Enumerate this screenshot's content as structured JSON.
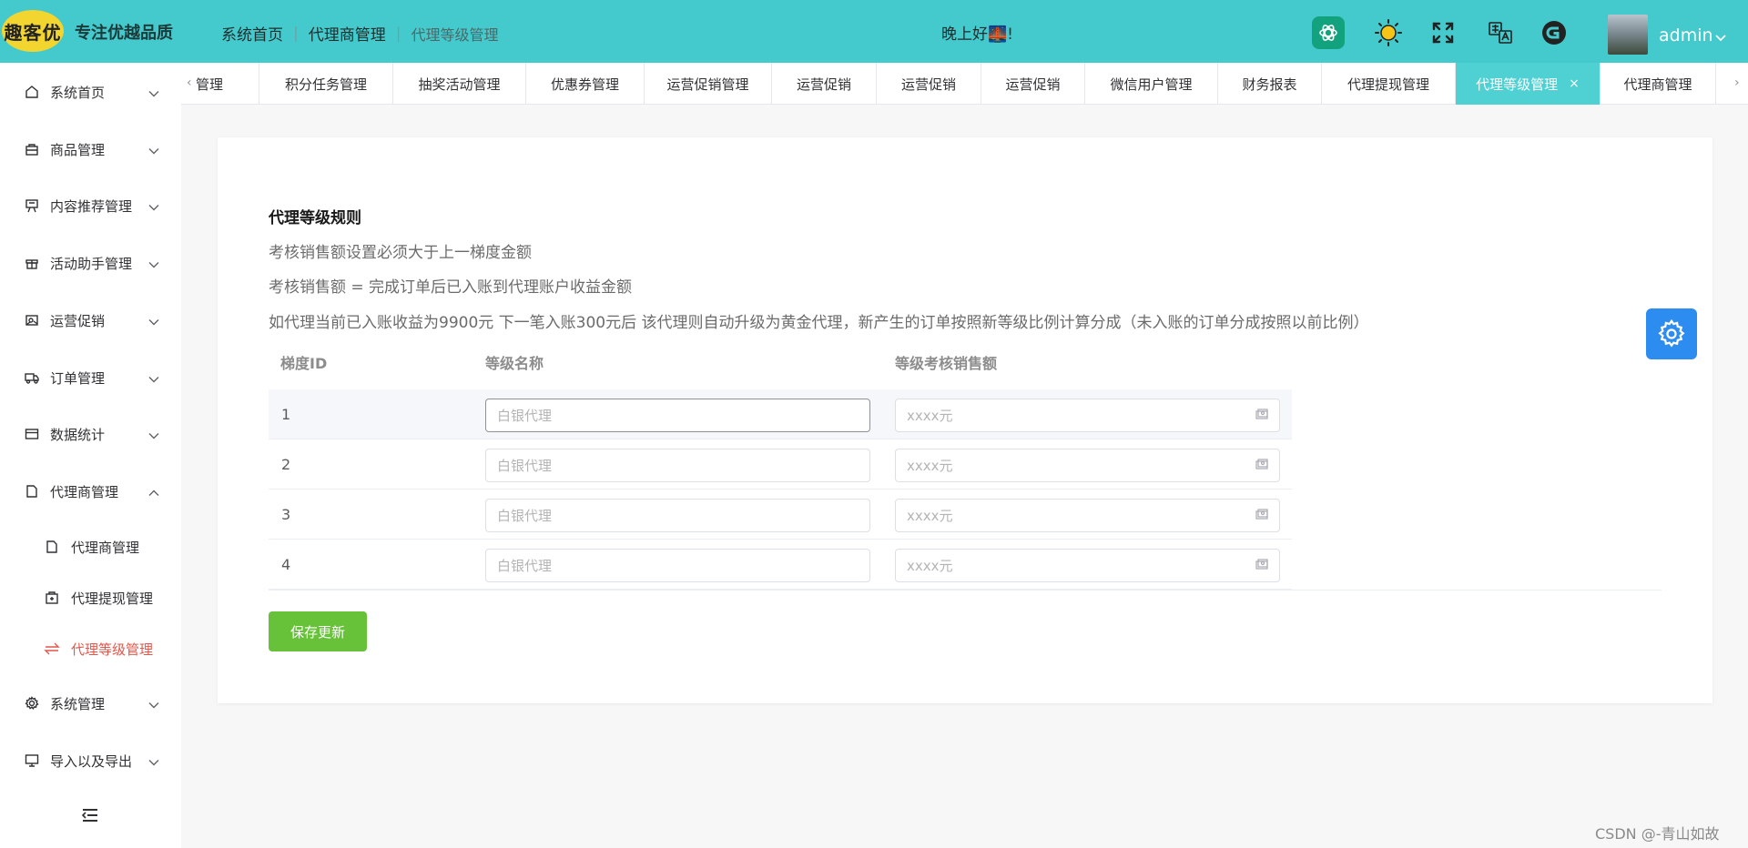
{
  "header": {
    "logo_text": "趣客优",
    "slogan": "专注优越品质",
    "breadcrumb": [
      "系统首页",
      "代理商管理",
      "代理等级管理"
    ],
    "greeting": "晚上好🌉!",
    "icons": [
      "chatgpt-icon",
      "sun-icon",
      "fullscreen-icon",
      "translate-icon",
      "gitee-icon"
    ],
    "username": "admin"
  },
  "sidebar": {
    "items": [
      {
        "label": "系统首页",
        "icon": "home-icon"
      },
      {
        "label": "商品管理",
        "icon": "bag-icon"
      },
      {
        "label": "内容推荐管理",
        "icon": "presentation-icon"
      },
      {
        "label": "活动助手管理",
        "icon": "gift-icon"
      },
      {
        "label": "运营促销",
        "icon": "promotion-icon"
      },
      {
        "label": "订单管理",
        "icon": "truck-icon"
      },
      {
        "label": "数据统计",
        "icon": "card-icon"
      },
      {
        "label": "代理商管理",
        "icon": "document-icon"
      },
      {
        "label": "系统管理",
        "icon": "gear-icon"
      },
      {
        "label": "导入以及导出",
        "icon": "monitor-icon"
      }
    ],
    "sub_items": [
      {
        "label": "代理商管理",
        "icon": "document-icon"
      },
      {
        "label": "代理提现管理",
        "icon": "wallet-icon"
      },
      {
        "label": "代理等级管理",
        "icon": "switch-icon"
      }
    ]
  },
  "tabs": {
    "items": [
      "管理",
      "积分任务管理",
      "抽奖活动管理",
      "优惠券管理",
      "运营促销管理",
      "运营促销",
      "运营促销",
      "运营促销",
      "微信用户管理",
      "财务报表",
      "代理提现管理",
      "代理等级管理",
      "代理商管理"
    ],
    "active_index": 11,
    "close_glyph": "×"
  },
  "rules": {
    "title": "代理等级规则",
    "lines": [
      "考核销售额设置必须大于上一梯度金额",
      "考核销售额 = 完成订单后已入账到代理账户收益金额",
      "如代理当前已入账收益为9900元 下一笔入账300元后 该代理则自动升级为黄金代理，新产生的订单按照新等级比例计算分成（未入账的订单分成按照以前比例）"
    ]
  },
  "table": {
    "headers": [
      "梯度ID",
      "等级名称",
      "等级考核销售额"
    ],
    "rows": [
      {
        "id": "1",
        "name_placeholder": "白银代理",
        "amount_placeholder": "xxxx元"
      },
      {
        "id": "2",
        "name_placeholder": "白银代理",
        "amount_placeholder": "xxxx元"
      },
      {
        "id": "3",
        "name_placeholder": "白银代理",
        "amount_placeholder": "xxxx元"
      },
      {
        "id": "4",
        "name_placeholder": "白银代理",
        "amount_placeholder": "xxxx元"
      }
    ]
  },
  "save_button": "保存更新",
  "watermark": "CSDN @-青山如故",
  "colors": {
    "header_bg": "#44c9cc",
    "active_tab": "#4fd0d3",
    "save_button": "#67c23a",
    "settings_fab": "#2d8cf0",
    "active_submenu": "#e2564b"
  }
}
